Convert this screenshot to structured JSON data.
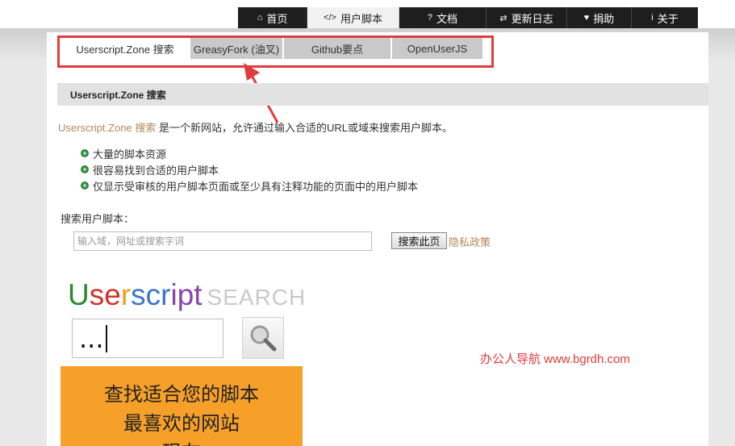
{
  "nav": {
    "items": [
      {
        "label": "首页",
        "icon": "home-icon",
        "glyph": "⌂"
      },
      {
        "label": "用户脚本",
        "icon": "code-icon",
        "glyph": "</>"
      },
      {
        "label": "文档",
        "icon": "question-icon",
        "glyph": "?"
      },
      {
        "label": "更新日志",
        "icon": "swap-arrows-icon",
        "glyph": "⇄"
      },
      {
        "label": "捐助",
        "icon": "heart-icon",
        "glyph": "♥"
      },
      {
        "label": "关于",
        "icon": "info-icon",
        "glyph": "i"
      }
    ],
    "active_index": 1
  },
  "tabs": [
    {
      "label": "Userscript.Zone 搜索"
    },
    {
      "label": "GreasyFork (油叉)"
    },
    {
      "label": "Github要点"
    },
    {
      "label": "OpenUserJS"
    }
  ],
  "section": {
    "title": "Userscript.Zone 搜索",
    "intro_brand": "Userscript.Zone 搜索",
    "intro_rest": " 是一个新网站，允许通过输入合适的URL或域来搜索用户脚本。",
    "features": [
      "大量的脚本资源",
      "很容易找到合适的用户脚本",
      "仅显示受审核的用户脚本页面或至少具有注释功能的页面中的用户脚本"
    ],
    "search_label": "搜索用户脚本：",
    "search_placeholder": "输入域，网址或搜索字词",
    "search_button": "搜索此页",
    "privacy_link": "隐私政策"
  },
  "banner": {
    "logo_parts": [
      "U",
      "se",
      "r",
      "scr",
      "ipt"
    ],
    "logo_search_word": "SEARCH",
    "mock_input_text": "...",
    "watermark": "办公人导航 www.bgrdh.com",
    "promo_lines": [
      "查找适合您的脚本",
      "最喜欢的网站",
      "现在"
    ]
  },
  "colors": {
    "highlight": "#e23b3b",
    "brand_link": "#b0895a",
    "promo_bg": "#f6a02a",
    "nav_bg": "#1e1e1e"
  }
}
